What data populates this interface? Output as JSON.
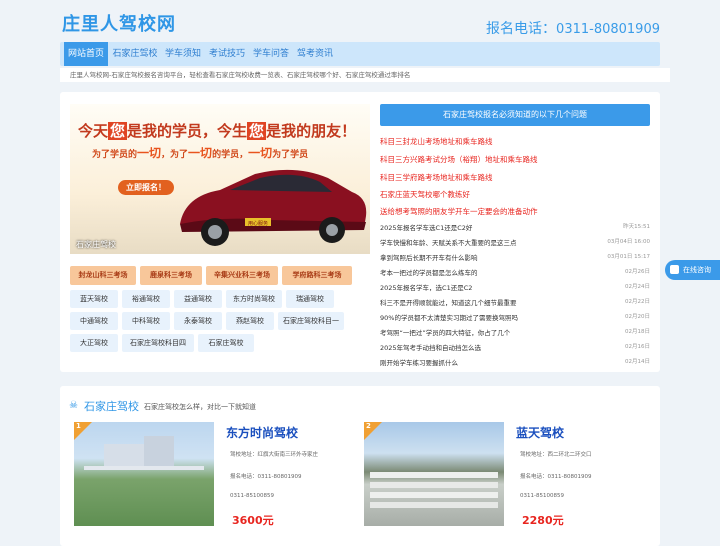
{
  "header": {
    "site_title": "庄里人驾校网",
    "phone_label": "报名电话：",
    "phone_number": "0311-80801909"
  },
  "nav": {
    "items": [
      "网站首页",
      "石家庄驾校",
      "学车须知",
      "考试技巧",
      "学车问答",
      "驾考资讯"
    ],
    "active_index": 0
  },
  "breadcrumb": "庄里人驾校网-石家庄驾校报名咨询平台，轻松查看石家庄驾校收费一览表、石家庄驾校哪个好、石家庄驾校通过率排名",
  "banner": {
    "line1_a": "今天",
    "line1_hl1": "您",
    "line1_b": "是我的学员，今生",
    "line1_hl2": "您",
    "line1_c": "是我的朋友！",
    "line2_a": "为了学员的",
    "line2_hl1": "一切",
    "line2_b": "，为了",
    "line2_hl2": "一切",
    "line2_c": "的学员，",
    "line2_hl3": "一切",
    "line2_d": "为了学员",
    "button": "立即报名！",
    "plate": "用心服务",
    "caption": "石家庄驾校"
  },
  "exam_sites": [
    "封龙山科三考场",
    "鹿泉科三考场",
    "辛集兴业科三考场",
    "学府路科三考场"
  ],
  "schools": [
    [
      "蓝天驾校",
      "裕通驾校",
      "益通驾校",
      "东方时尚驾校",
      "瑞通驾校"
    ],
    [
      "中通驾校",
      "中科驾校",
      "永泰驾校",
      "燕赵驾校",
      "石家庄驾校科目一"
    ],
    [
      "大正驾校",
      "石家庄驾校科目四",
      "石家庄驾校"
    ]
  ],
  "faq": {
    "title": "石家庄驾校报名必须知道的以下几个问题",
    "hot_links": [
      "科目三封龙山考场地址和乘车路线",
      "科目三方兴路考试分场（裕翔）地址和乘车路线",
      "科目三学府路考场地址和乘车路线",
      "石家庄蓝天驾校哪个教练好",
      "送给想考驾照的朋友学开车一定要会的准备动作"
    ],
    "news": [
      {
        "title": "2025年报名学车选C1还是C2好",
        "date": "昨天15:51"
      },
      {
        "title": "学车快慢和年龄、天赋关系不大重要的是这三点",
        "date": "03月04日 16:00"
      },
      {
        "title": "拿到驾照后长期不开车有什么影响",
        "date": "03月01日 15:17"
      },
      {
        "title": "考本一把过的学员都是怎么练车的",
        "date": "02月26日"
      },
      {
        "title": "2025年报名学车，选C1还是C2",
        "date": "02月24日"
      },
      {
        "title": "科三不是开得顺就能过，知道这几个细节最重要",
        "date": "02月22日"
      },
      {
        "title": "90%的学员都不太清楚实习期过了需要换驾照吗",
        "date": "02月20日"
      },
      {
        "title": "考驾照“一把过”学员的四大特征，你占了几个",
        "date": "02月18日"
      },
      {
        "title": "2025年驾考手动挡和自动挡怎么选",
        "date": "02月16日"
      },
      {
        "title": "刚开始学车练习要握抓什么",
        "date": "02月14日"
      }
    ]
  },
  "float_button": "在线咨询",
  "school_section": {
    "title": "石家庄驾校",
    "subtitle": "石家庄驾校怎么样，对比一下就知道",
    "cards": [
      {
        "rank": "1",
        "name": "东方时尚驾校",
        "address": "驾校地址：红旗大街南三环外寺家庄",
        "phone": "报名电话：0311-80801909",
        "phone2": "0311-85100859",
        "price": "3600元"
      },
      {
        "rank": "2",
        "name": "蓝天驾校",
        "address": "驾校地址：西二环北二环交口",
        "phone": "报名电话：0311-80801909",
        "phone2": "0311-85100859",
        "price": "2280元"
      }
    ]
  },
  "colors": {
    "brand_blue": "#3b9ae9",
    "hot_red": "#e8251f",
    "exam_tag_bg": "#f8c79a",
    "school_tag_bg": "#e8f2fc",
    "page_bg": "#eef3f8"
  }
}
